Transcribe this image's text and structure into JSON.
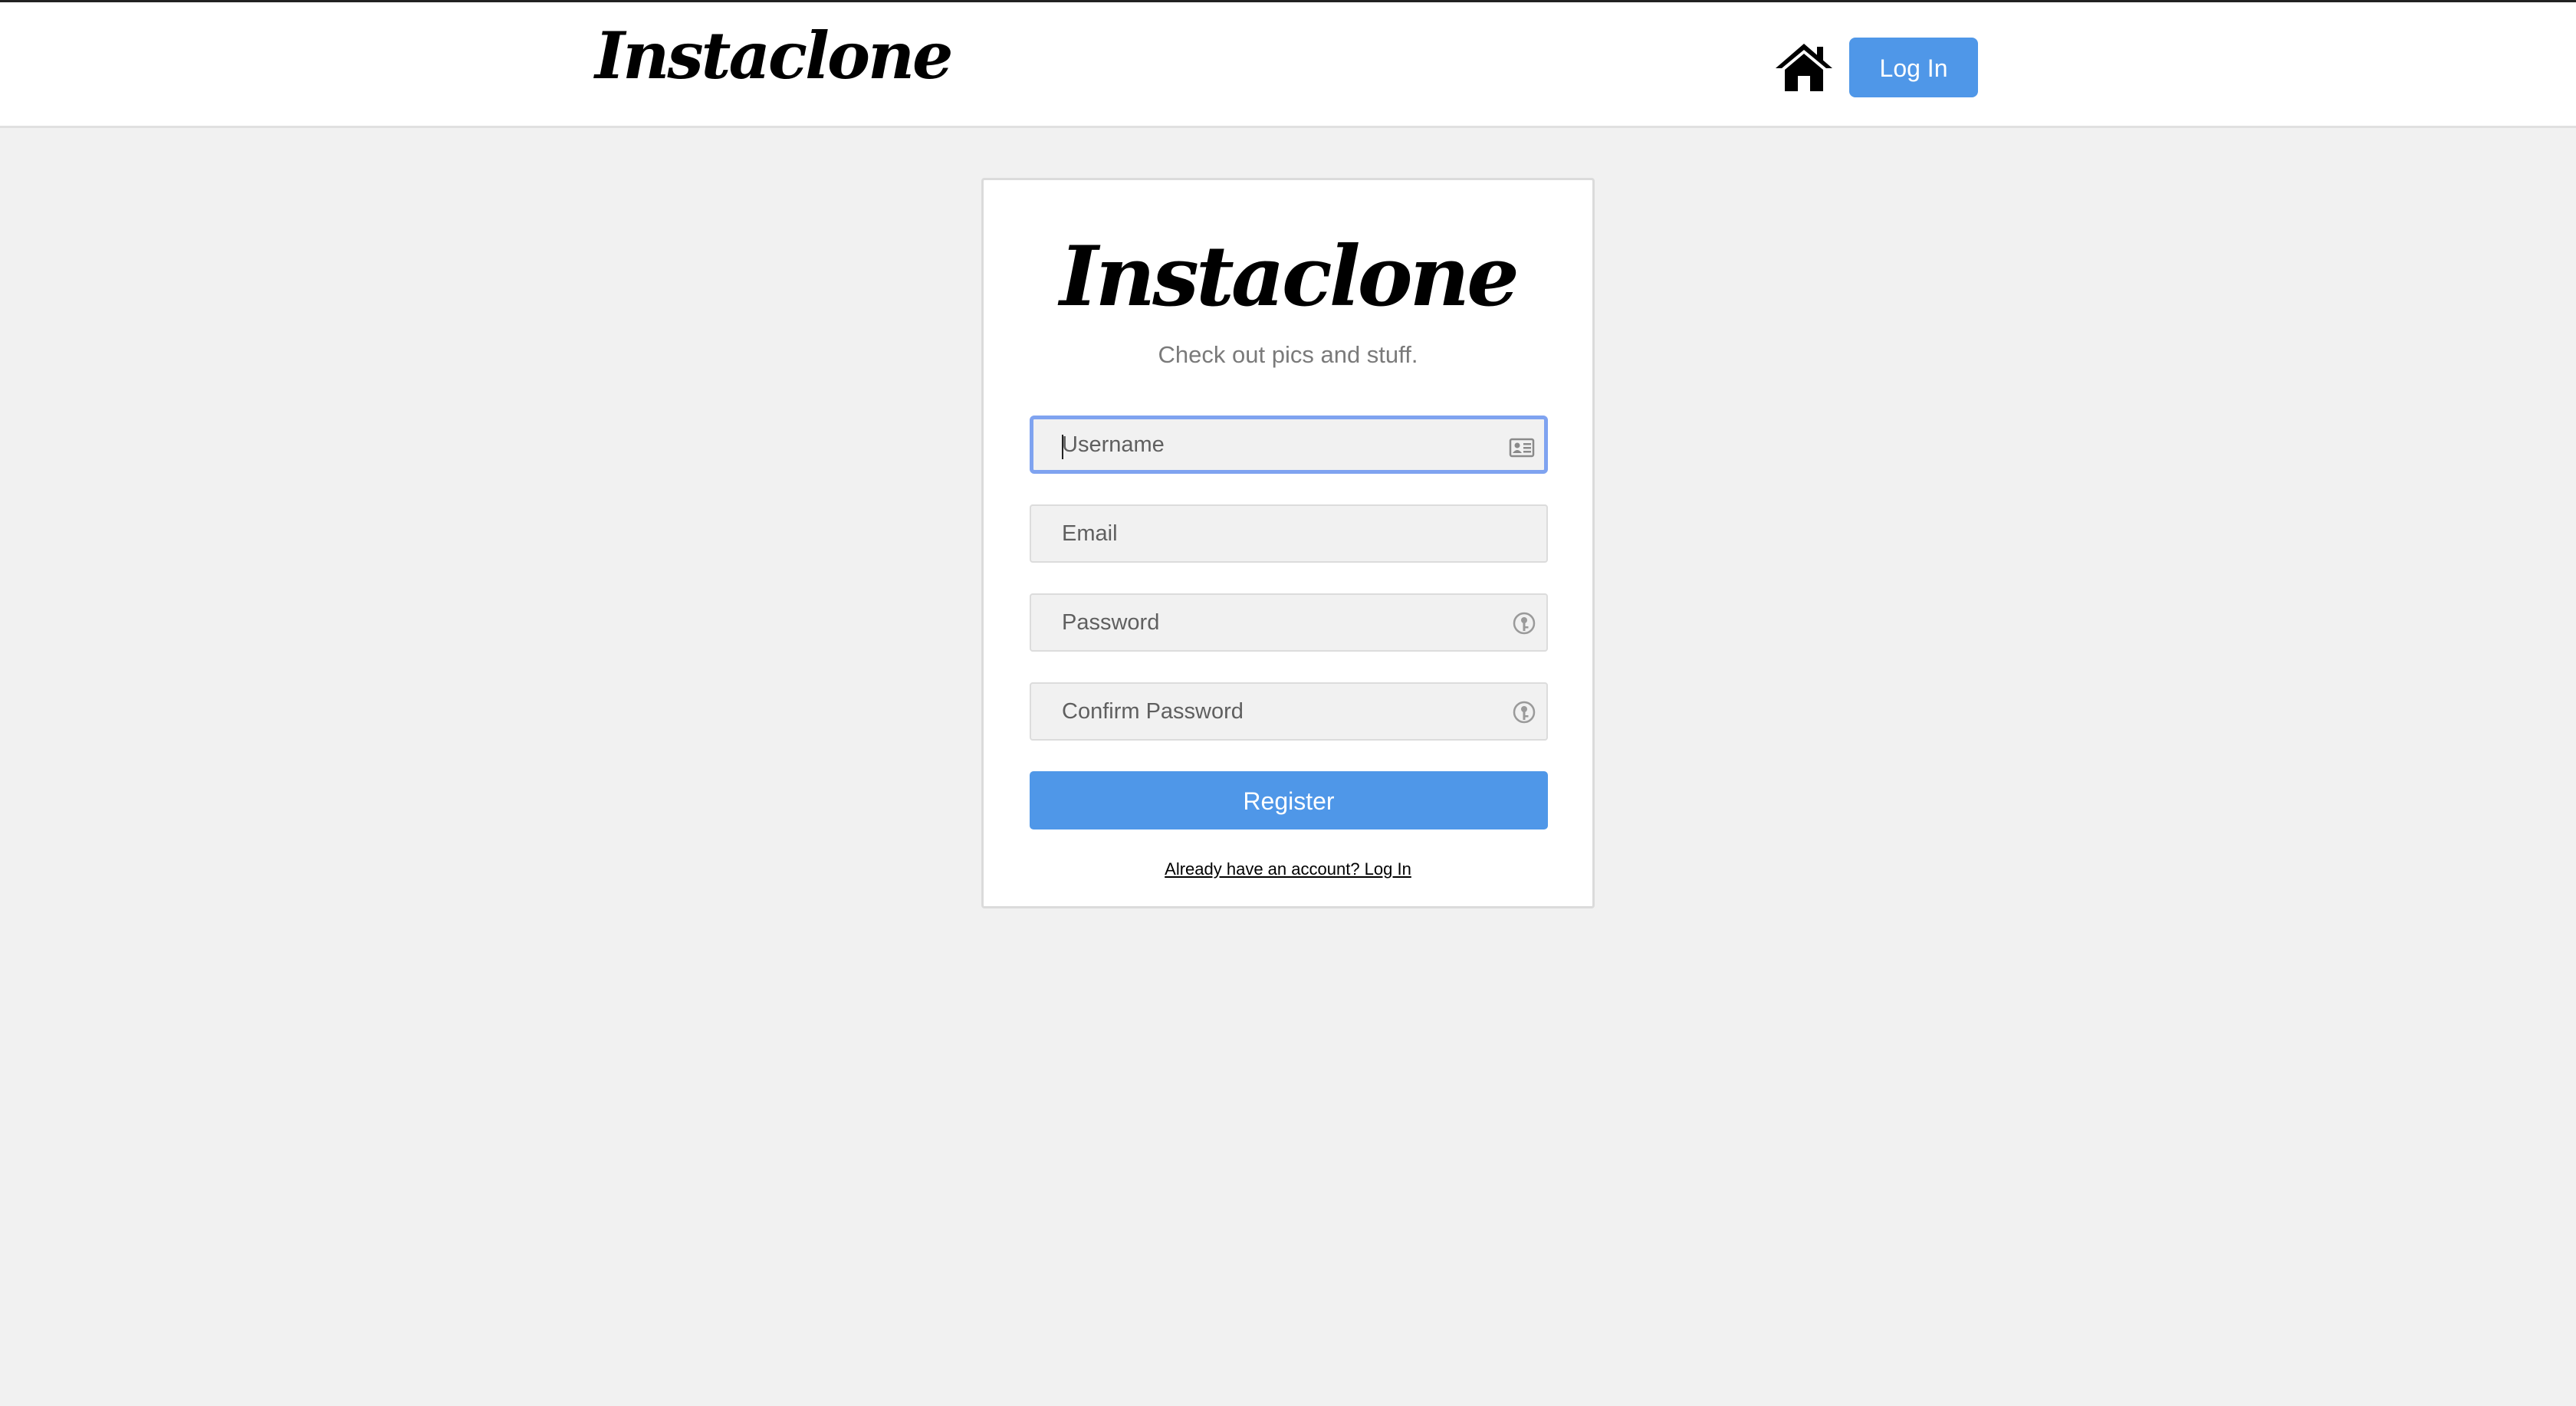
{
  "navbar": {
    "brand": "Instaclone",
    "home_icon": "home-icon",
    "login_label": "Log In"
  },
  "register_card": {
    "title": "Instaclone",
    "subtitle": "Check out pics and stuff.",
    "fields": {
      "username": {
        "placeholder": "Username",
        "value": "",
        "icon": "contact-card-icon"
      },
      "email": {
        "placeholder": "Email",
        "value": ""
      },
      "password": {
        "placeholder": "Password",
        "value": "",
        "icon": "password-key-icon"
      },
      "confirm_password": {
        "placeholder": "Confirm Password",
        "value": "",
        "icon": "password-key-icon"
      }
    },
    "register_label": "Register",
    "login_link": "Already have an account? Log In"
  },
  "colors": {
    "accent": "#4f97e8",
    "background": "#f1f1f1",
    "focus_ring": "#7fa3f0"
  }
}
